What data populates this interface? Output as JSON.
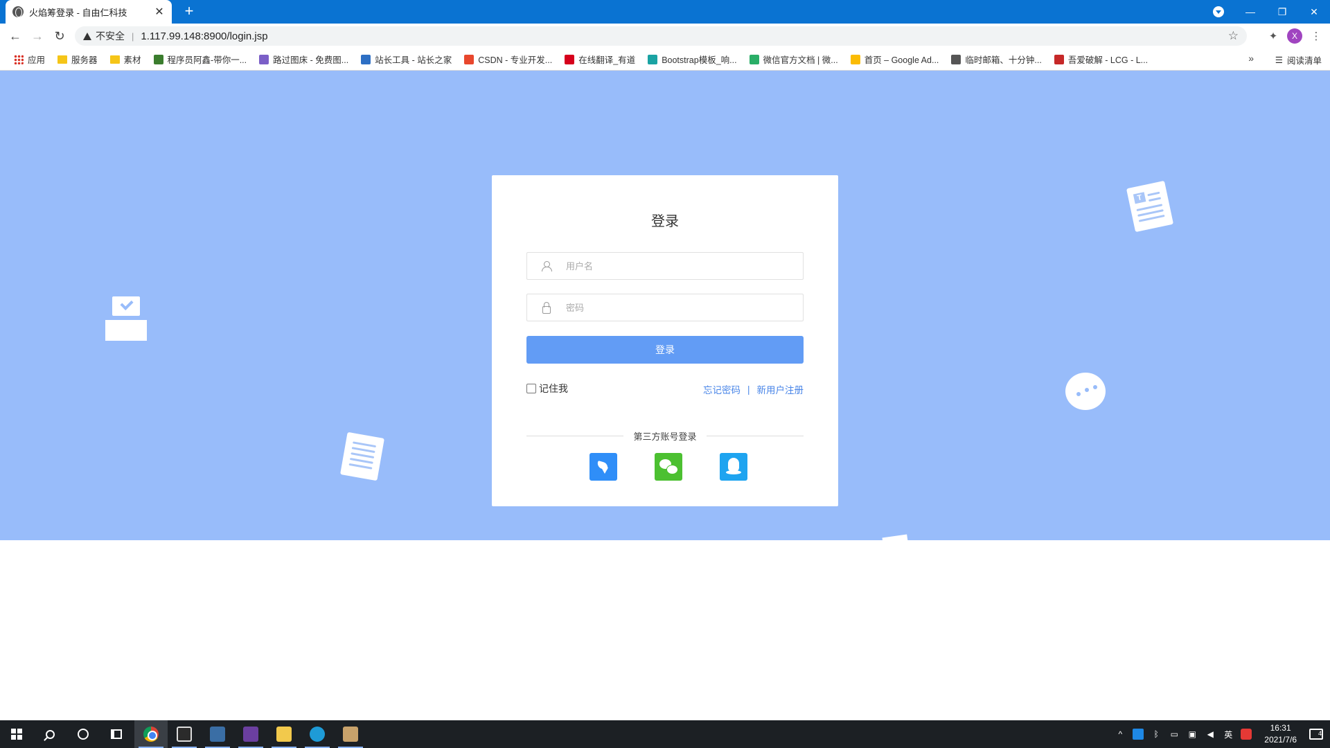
{
  "browser": {
    "tab_title": "火焰筹登录 - 自由仁科技",
    "tab_close": "✕",
    "new_tab": "+",
    "insecure_label": "不安全",
    "url": "1.117.99.148:8900/login.jsp",
    "profile_initial": "X",
    "bookmarks": [
      {
        "label": "应用",
        "icon": "apps-icon",
        "color": "#d93025"
      },
      {
        "label": "服务器",
        "icon": "folder-icon",
        "color": "#f5c518"
      },
      {
        "label": "素材",
        "icon": "folder-icon",
        "color": "#f5c518"
      },
      {
        "label": "程序员阿鑫-带你一...",
        "icon": "site-icon",
        "color": "#3b7d2e"
      },
      {
        "label": "路过图床 - 免费图...",
        "icon": "site-icon",
        "color": "#7b5fc7"
      },
      {
        "label": "站长工具 - 站长之家",
        "icon": "site-icon",
        "color": "#2d6fc4"
      },
      {
        "label": "CSDN - 专业开发...",
        "icon": "site-icon",
        "color": "#e8472d"
      },
      {
        "label": "在线翻译_有道",
        "icon": "site-icon",
        "color": "#d6001c"
      },
      {
        "label": "Bootstrap模板_响...",
        "icon": "site-icon",
        "color": "#1aa3a3"
      },
      {
        "label": "微信官方文档 | 微...",
        "icon": "site-icon",
        "color": "#2aae67"
      },
      {
        "label": "首页 – Google Ad...",
        "icon": "site-icon",
        "color": "#fbbc04"
      },
      {
        "label": "临时邮箱、十分钟...",
        "icon": "site-icon",
        "color": "#555555"
      },
      {
        "label": "吾爱破解 - LCG - L...",
        "icon": "site-icon",
        "color": "#c62828"
      }
    ],
    "bookmarks_more": "»",
    "reading_list": "阅读清单"
  },
  "login": {
    "title": "登录",
    "username_placeholder": "用户名",
    "password_placeholder": "密码",
    "submit_label": "登录",
    "remember_label": "记住我",
    "forgot_label": "忘记密码",
    "links_separator": "|",
    "register_label": "新用户注册",
    "third_party_label": "第三方账号登录",
    "deco_doc_letter": "T"
  },
  "taskbar": {
    "tray_lang": "英",
    "time": "16:31",
    "date": "2021/7/6",
    "notification_count": "4"
  },
  "colors": {
    "page_bg": "#98bcfa",
    "primary_button": "#629cf5",
    "link": "#4a86e8",
    "tab_strip": "#0a73d2"
  }
}
